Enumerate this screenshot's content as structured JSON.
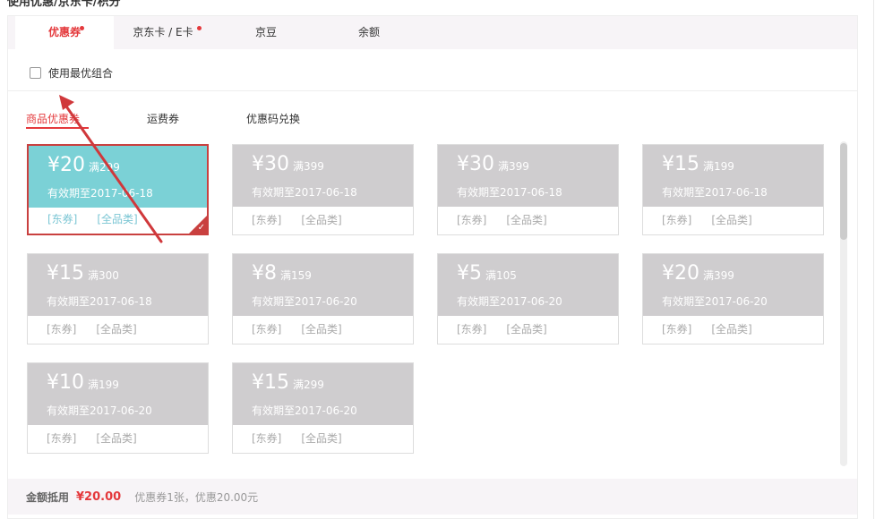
{
  "section_title": "使用优惠/京东卡/积分",
  "tabs": [
    {
      "label": "优惠券",
      "dot": true,
      "active": true
    },
    {
      "label": "京东卡 / E卡",
      "dot": true,
      "active": false
    },
    {
      "label": "京豆",
      "dot": false,
      "active": false
    },
    {
      "label": "余额",
      "dot": false,
      "active": false
    }
  ],
  "best_combo_label": "使用最优组合",
  "subtabs": [
    {
      "label": "商品优惠券",
      "active": true
    },
    {
      "label": "运费券",
      "active": false
    },
    {
      "label": "优惠码兑换",
      "active": false
    }
  ],
  "coupons": [
    {
      "amount": "¥20",
      "condition": "满299",
      "validity": "有效期至2017-06-18",
      "tag1": "[东券]",
      "tag2": "[全品类]",
      "selected": true
    },
    {
      "amount": "¥30",
      "condition": "满399",
      "validity": "有效期至2017-06-18",
      "tag1": "[东券]",
      "tag2": "[全品类]",
      "selected": false
    },
    {
      "amount": "¥30",
      "condition": "满399",
      "validity": "有效期至2017-06-18",
      "tag1": "[东券]",
      "tag2": "[全品类]",
      "selected": false
    },
    {
      "amount": "¥15",
      "condition": "满199",
      "validity": "有效期至2017-06-18",
      "tag1": "[东券]",
      "tag2": "[全品类]",
      "selected": false
    },
    {
      "amount": "¥15",
      "condition": "满300",
      "validity": "有效期至2017-06-18",
      "tag1": "[东券]",
      "tag2": "[全品类]",
      "selected": false
    },
    {
      "amount": "¥8",
      "condition": "满159",
      "validity": "有效期至2017-06-20",
      "tag1": "[东券]",
      "tag2": "[全品类]",
      "selected": false
    },
    {
      "amount": "¥5",
      "condition": "满105",
      "validity": "有效期至2017-06-20",
      "tag1": "[东券]",
      "tag2": "[全品类]",
      "selected": false
    },
    {
      "amount": "¥20",
      "condition": "满399",
      "validity": "有效期至2017-06-20",
      "tag1": "[东券]",
      "tag2": "[全品类]",
      "selected": false
    },
    {
      "amount": "¥10",
      "condition": "满199",
      "validity": "有效期至2017-06-20",
      "tag1": "[东券]",
      "tag2": "[全品类]",
      "selected": false
    },
    {
      "amount": "¥15",
      "condition": "满299",
      "validity": "有效期至2017-06-20",
      "tag1": "[东券]",
      "tag2": "[全品类]",
      "selected": false
    }
  ],
  "footer": {
    "label": "金额抵用",
    "amount": "¥20.00",
    "info": "优惠券1张，优惠20.00元"
  },
  "colors": {
    "accent": "#e4393c",
    "selected_coupon": "#7bd1d6",
    "inactive_coupon": "#cfcdcf",
    "annotation_arrow": "#d0383b"
  },
  "icons": {
    "checkbox": "checkbox-icon",
    "selected_check": "check-icon",
    "annotation": "arrow-icon"
  }
}
